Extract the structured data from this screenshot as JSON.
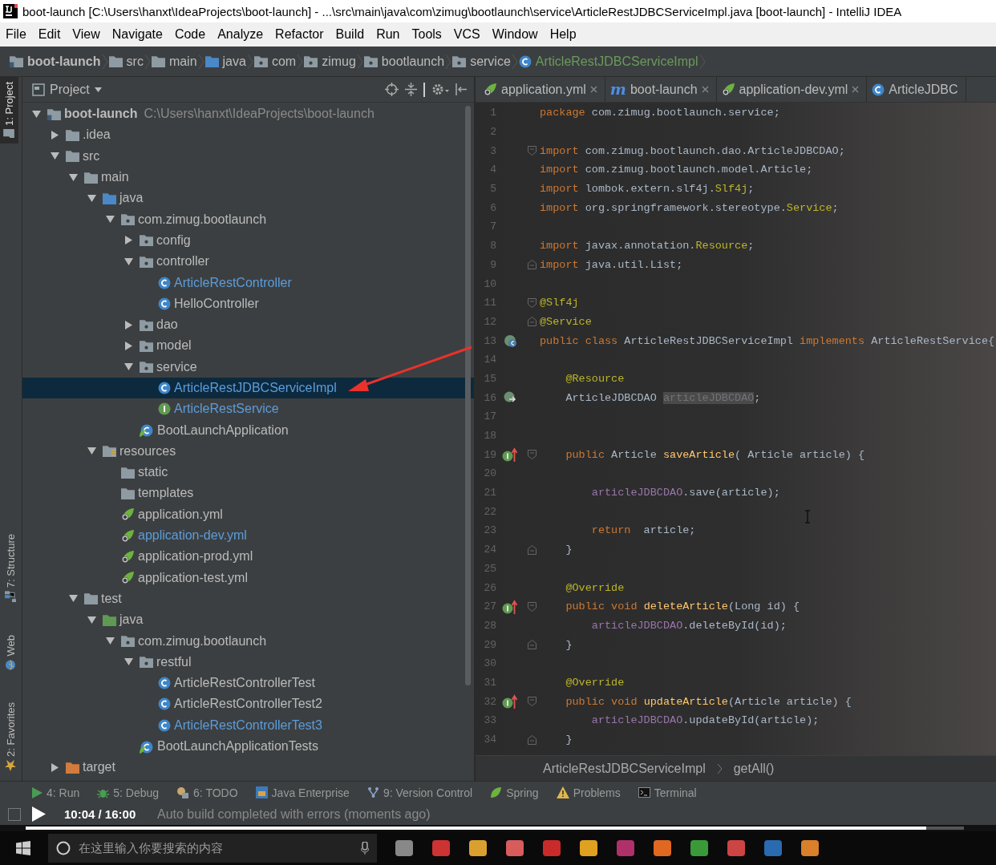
{
  "window": {
    "title": "boot-launch [C:\\Users\\hanxt\\IdeaProjects\\boot-launch] - ...\\src\\main\\java\\com\\zimug\\bootlaunch\\service\\ArticleRestJDBCServiceImpl.java [boot-launch] - IntelliJ IDEA"
  },
  "menu": [
    "File",
    "Edit",
    "View",
    "Navigate",
    "Code",
    "Analyze",
    "Refactor",
    "Build",
    "Run",
    "Tools",
    "VCS",
    "Window",
    "Help"
  ],
  "navigation_bar": [
    {
      "label": "boot-launch",
      "kind": "module",
      "added": false
    },
    {
      "label": "src",
      "kind": "folder",
      "added": false
    },
    {
      "label": "main",
      "kind": "folder",
      "added": false
    },
    {
      "label": "java",
      "kind": "source-folder",
      "added": false
    },
    {
      "label": "com",
      "kind": "package",
      "added": false
    },
    {
      "label": "zimug",
      "kind": "package",
      "added": false
    },
    {
      "label": "bootlaunch",
      "kind": "package",
      "added": false
    },
    {
      "label": "service",
      "kind": "package",
      "added": false
    },
    {
      "label": "ArticleRestJDBCServiceImpl",
      "kind": "class",
      "added": true
    }
  ],
  "side_tabs_top": [
    {
      "label": "1: Project",
      "selected": true
    }
  ],
  "side_tabs_bottom": [
    {
      "label": "7: Structure",
      "selected": false
    },
    {
      "label": "Web",
      "selected": false
    },
    {
      "label": "2: Favorites",
      "selected": false
    }
  ],
  "project_panel": {
    "title": "Project",
    "tree": [
      {
        "label": "boot-launch",
        "kind": "module",
        "path": "C:\\Users\\hanxt\\IdeaProjects\\boot-launch",
        "expanded": true,
        "selected": false,
        "modified": false,
        "children": [
          {
            "label": ".idea",
            "kind": "folder",
            "expanded": false,
            "selected": false,
            "modified": false
          },
          {
            "label": "src",
            "kind": "folder",
            "expanded": true,
            "selected": false,
            "modified": false,
            "children": [
              {
                "label": "main",
                "kind": "folder",
                "expanded": true,
                "selected": false,
                "modified": false,
                "children": [
                  {
                    "label": "java",
                    "kind": "source-folder",
                    "expanded": true,
                    "selected": false,
                    "modified": false,
                    "children": [
                      {
                        "label": "com.zimug.bootlaunch",
                        "kind": "package",
                        "expanded": true,
                        "selected": false,
                        "modified": false,
                        "children": [
                          {
                            "label": "config",
                            "kind": "package",
                            "expanded": false,
                            "selected": false,
                            "modified": false
                          },
                          {
                            "label": "controller",
                            "kind": "package",
                            "expanded": true,
                            "selected": false,
                            "modified": false,
                            "children": [
                              {
                                "label": "ArticleRestController",
                                "kind": "class",
                                "selected": false,
                                "modified": true
                              },
                              {
                                "label": "HelloController",
                                "kind": "class",
                                "selected": false,
                                "modified": false
                              }
                            ]
                          },
                          {
                            "label": "dao",
                            "kind": "package",
                            "expanded": false,
                            "selected": false,
                            "modified": false
                          },
                          {
                            "label": "model",
                            "kind": "package",
                            "expanded": false,
                            "selected": false,
                            "modified": false
                          },
                          {
                            "label": "service",
                            "kind": "package",
                            "expanded": true,
                            "selected": false,
                            "modified": false,
                            "children": [
                              {
                                "label": "ArticleRestJDBCServiceImpl",
                                "kind": "class",
                                "selected": true,
                                "modified": true
                              },
                              {
                                "label": "ArticleRestService",
                                "kind": "interface",
                                "selected": false,
                                "modified": true
                              }
                            ]
                          },
                          {
                            "label": "BootLaunchApplication",
                            "kind": "app-class",
                            "selected": false,
                            "modified": false
                          }
                        ]
                      }
                    ]
                  },
                  {
                    "label": "resources",
                    "kind": "resources-folder",
                    "expanded": true,
                    "selected": false,
                    "modified": false,
                    "children": [
                      {
                        "label": "static",
                        "kind": "empty-folder",
                        "selected": false,
                        "modified": false
                      },
                      {
                        "label": "templates",
                        "kind": "empty-folder",
                        "selected": false,
                        "modified": false
                      },
                      {
                        "label": "application.yml",
                        "kind": "yml",
                        "selected": false,
                        "modified": false
                      },
                      {
                        "label": "application-dev.yml",
                        "kind": "yml",
                        "selected": false,
                        "modified": true
                      },
                      {
                        "label": "application-prod.yml",
                        "kind": "yml",
                        "selected": false,
                        "modified": false
                      },
                      {
                        "label": "application-test.yml",
                        "kind": "yml",
                        "selected": false,
                        "modified": false
                      }
                    ]
                  }
                ]
              },
              {
                "label": "test",
                "kind": "folder",
                "expanded": true,
                "selected": false,
                "modified": false,
                "children": [
                  {
                    "label": "java",
                    "kind": "test-folder",
                    "expanded": true,
                    "selected": false,
                    "modified": false,
                    "children": [
                      {
                        "label": "com.zimug.bootlaunch",
                        "kind": "package",
                        "expanded": true,
                        "selected": false,
                        "modified": false,
                        "children": [
                          {
                            "label": "restful",
                            "kind": "package",
                            "expanded": true,
                            "selected": false,
                            "modified": false,
                            "children": [
                              {
                                "label": "ArticleRestControllerTest",
                                "kind": "class",
                                "selected": false,
                                "modified": false
                              },
                              {
                                "label": "ArticleRestControllerTest2",
                                "kind": "class",
                                "selected": false,
                                "modified": false
                              },
                              {
                                "label": "ArticleRestControllerTest3",
                                "kind": "class",
                                "selected": false,
                                "modified": true
                              }
                            ]
                          },
                          {
                            "label": "BootLaunchApplicationTests",
                            "kind": "app-class",
                            "selected": false,
                            "modified": false
                          }
                        ]
                      }
                    ]
                  }
                ]
              }
            ]
          },
          {
            "label": "target",
            "kind": "excluded-folder",
            "expanded": false,
            "selected": false,
            "modified": false
          }
        ]
      }
    ]
  },
  "editor": {
    "tabs": [
      {
        "label": "application.yml",
        "kind": "yml",
        "selected": false
      },
      {
        "label": "boot-launch",
        "kind": "maven",
        "glyph": "m",
        "selected": false
      },
      {
        "label": "application-dev.yml",
        "kind": "yml",
        "selected": false
      },
      {
        "label": "ArticleJDBC",
        "kind": "class",
        "selected": false
      }
    ],
    "lines": [
      {
        "number": "1",
        "tokens": [
          {
            "kind": "keyword",
            "text": "package"
          },
          {
            "kind": "plain",
            "text": " com.zimug.bootlaunch.service;"
          }
        ]
      },
      {
        "number": "2"
      },
      {
        "number": "3",
        "fold": {
          "kind": "start"
        },
        "tokens": [
          {
            "kind": "keyword",
            "text": "import"
          },
          {
            "kind": "plain",
            "text": " com.zimug.bootlaunch.dao.ArticleJDBCDAO;"
          }
        ]
      },
      {
        "number": "4",
        "tokens": [
          {
            "kind": "keyword",
            "text": "import"
          },
          {
            "kind": "plain",
            "text": " com.zimug.bootlaunch.model.Article;"
          }
        ]
      },
      {
        "number": "5",
        "tokens": [
          {
            "kind": "keyword",
            "text": "import"
          },
          {
            "kind": "plain",
            "text": " lombok.extern.slf4j."
          },
          {
            "kind": "annotation",
            "text": "Slf4j"
          },
          {
            "kind": "plain",
            "text": ";"
          }
        ]
      },
      {
        "number": "6",
        "tokens": [
          {
            "kind": "keyword",
            "text": "import"
          },
          {
            "kind": "plain",
            "text": " org.springframework.stereotype."
          },
          {
            "kind": "annotation",
            "text": "Service"
          },
          {
            "kind": "plain",
            "text": ";"
          }
        ]
      },
      {
        "number": "7"
      },
      {
        "number": "8",
        "tokens": [
          {
            "kind": "keyword",
            "text": "import"
          },
          {
            "kind": "plain",
            "text": " javax.annotation."
          },
          {
            "kind": "annotation",
            "text": "Resource"
          },
          {
            "kind": "plain",
            "text": ";"
          }
        ]
      },
      {
        "number": "9",
        "fold": {
          "kind": "end"
        },
        "tokens": [
          {
            "kind": "keyword",
            "text": "import"
          },
          {
            "kind": "plain",
            "text": " java.util.List;"
          }
        ]
      },
      {
        "number": "10"
      },
      {
        "number": "11",
        "fold": {
          "kind": "start"
        },
        "tokens": [
          {
            "kind": "annotation",
            "text": "@Slf4j"
          }
        ]
      },
      {
        "number": "12",
        "fold": {
          "kind": "end"
        },
        "tokens": [
          {
            "kind": "annotation",
            "text": "@Service"
          }
        ]
      },
      {
        "number": "13",
        "marker": {
          "kind": "bean"
        },
        "tokens": [
          {
            "kind": "keyword",
            "text": "public class"
          },
          {
            "kind": "plain",
            "text": " ArticleRestJDBCServiceImpl "
          },
          {
            "kind": "keyword",
            "text": "implements"
          },
          {
            "kind": "plain",
            "text": " ArticleRestService{"
          }
        ]
      },
      {
        "number": "14"
      },
      {
        "number": "15",
        "tokens": [
          {
            "kind": "annotation",
            "text": "    @Resource"
          }
        ]
      },
      {
        "number": "16",
        "marker": {
          "kind": "injection"
        },
        "tokens": [
          {
            "kind": "plain",
            "text": "    ArticleJDBCDAO "
          },
          {
            "kind": "unused",
            "text": "articleJDBCDAO"
          },
          {
            "kind": "plain",
            "text": ";"
          }
        ]
      },
      {
        "number": "17"
      },
      {
        "number": "18"
      },
      {
        "number": "19",
        "marker": {
          "kind": "implements"
        },
        "fold": {
          "kind": "start"
        },
        "tokens": [
          {
            "kind": "keyword",
            "text": "    public"
          },
          {
            "kind": "plain",
            "text": " Article "
          },
          {
            "kind": "method",
            "text": "saveArticle"
          },
          {
            "kind": "plain",
            "text": "( Article article) {"
          }
        ]
      },
      {
        "number": "20"
      },
      {
        "number": "21",
        "tokens": [
          {
            "kind": "field",
            "text": "        articleJDBCDAO"
          },
          {
            "kind": "plain",
            "text": ".save(article);"
          }
        ]
      },
      {
        "number": "22"
      },
      {
        "number": "23",
        "tokens": [
          {
            "kind": "keyword",
            "text": "        return"
          },
          {
            "kind": "plain",
            "text": "  article;"
          }
        ]
      },
      {
        "number": "24",
        "fold": {
          "kind": "end"
        },
        "tokens": [
          {
            "kind": "plain",
            "text": "    }"
          }
        ]
      },
      {
        "number": "25"
      },
      {
        "number": "26",
        "tokens": [
          {
            "kind": "annotation",
            "text": "    @Override"
          }
        ]
      },
      {
        "number": "27",
        "marker": {
          "kind": "implements"
        },
        "fold": {
          "kind": "start"
        },
        "tokens": [
          {
            "kind": "keyword",
            "text": "    public void"
          },
          {
            "kind": "method",
            "text": " deleteArticle"
          },
          {
            "kind": "plain",
            "text": "(Long id) {"
          }
        ]
      },
      {
        "number": "28",
        "tokens": [
          {
            "kind": "field",
            "text": "        articleJDBCDAO"
          },
          {
            "kind": "plain",
            "text": ".deleteById(id);"
          }
        ]
      },
      {
        "number": "29",
        "fold": {
          "kind": "end"
        },
        "tokens": [
          {
            "kind": "plain",
            "text": "    }"
          }
        ]
      },
      {
        "number": "30"
      },
      {
        "number": "31",
        "tokens": [
          {
            "kind": "annotation",
            "text": "    @Override"
          }
        ]
      },
      {
        "number": "32",
        "marker": {
          "kind": "implements"
        },
        "fold": {
          "kind": "start"
        },
        "tokens": [
          {
            "kind": "keyword",
            "text": "    public void"
          },
          {
            "kind": "method",
            "text": " updateArticle"
          },
          {
            "kind": "plain",
            "text": "(Article article) {"
          }
        ]
      },
      {
        "number": "33",
        "tokens": [
          {
            "kind": "field",
            "text": "        articleJDBCDAO"
          },
          {
            "kind": "plain",
            "text": ".updateById(article);"
          }
        ]
      },
      {
        "number": "34",
        "fold": {
          "kind": "end"
        },
        "tokens": [
          {
            "kind": "plain",
            "text": "    }"
          }
        ]
      }
    ],
    "breadcrumb": [
      "ArticleRestJDBCServiceImpl",
      "getAll()"
    ]
  },
  "tool_windows": [
    {
      "label": "4: Run",
      "kind": "run"
    },
    {
      "label": "5: Debug",
      "kind": "debug"
    },
    {
      "label": "6: TODO",
      "kind": "todo"
    },
    {
      "label": "Java Enterprise",
      "kind": "enterprise"
    },
    {
      "label": "9: Version Control",
      "kind": "vcs"
    },
    {
      "label": "Spring",
      "kind": "leaf"
    },
    {
      "label": "Problems",
      "kind": "warning"
    },
    {
      "label": "Terminal",
      "kind": "terminal"
    }
  ],
  "status_bar": {
    "message": "Auto build completed with errors (moments ago)"
  },
  "video_player": {
    "time": "10:04 / 16:00",
    "level": 0.96
  },
  "taskbar": {
    "search_placeholder": "在这里输入你要搜索的内容"
  }
}
